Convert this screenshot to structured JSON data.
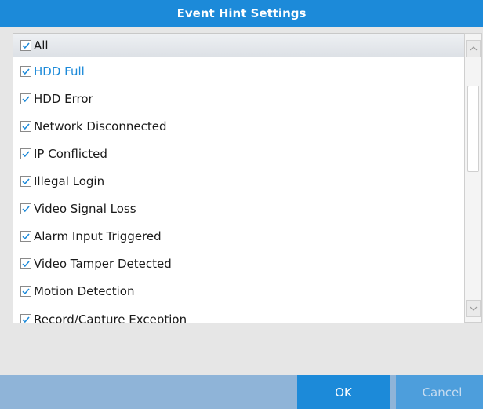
{
  "dialog": {
    "title": "Event Hint Settings"
  },
  "all_item": {
    "label": "All",
    "checked": true
  },
  "items": [
    {
      "label": "HDD Full",
      "checked": true,
      "selected": true
    },
    {
      "label": "HDD Error",
      "checked": true
    },
    {
      "label": "Network Disconnected",
      "checked": true
    },
    {
      "label": "IP Conflicted",
      "checked": true
    },
    {
      "label": "Illegal Login",
      "checked": true
    },
    {
      "label": "Video Signal Loss",
      "checked": true
    },
    {
      "label": "Alarm Input Triggered",
      "checked": true
    },
    {
      "label": "Video Tamper Detected",
      "checked": true
    },
    {
      "label": "Motion Detection",
      "checked": true
    },
    {
      "label": "Record/Capture Exception",
      "checked": true
    }
  ],
  "buttons": {
    "ok_label": "OK",
    "cancel_label": "Cancel"
  },
  "colors": {
    "accent": "#1c8ad9",
    "check": "#1c8ad9",
    "footer": "#8fb4d8"
  }
}
